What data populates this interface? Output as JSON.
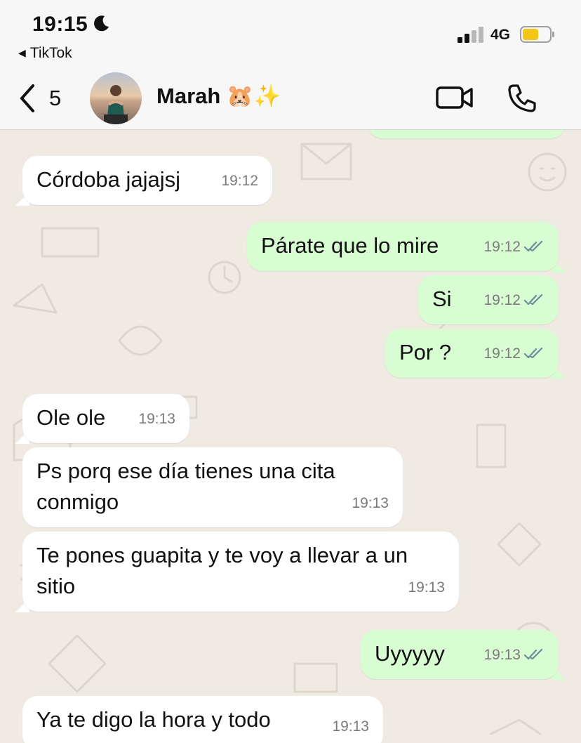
{
  "status_bar": {
    "time": "19:15",
    "back_app": "TikTok",
    "network": "4G"
  },
  "header": {
    "unread_count": "5",
    "contact_name": "Marah 🐹✨"
  },
  "messages": [
    {
      "direction": "in",
      "text": "Córdoba jajajsj",
      "time": "19:12"
    },
    {
      "direction": "out",
      "text": "Párate que lo mire",
      "time": "19:12",
      "status": "read"
    },
    {
      "direction": "out",
      "text": "Si",
      "time": "19:12",
      "status": "read"
    },
    {
      "direction": "out",
      "text": "Por ?",
      "time": "19:12",
      "status": "read"
    },
    {
      "direction": "in",
      "text": "Ole ole",
      "time": "19:13"
    },
    {
      "direction": "in",
      "text": "Ps porq ese día tienes una cita conmigo",
      "time": "19:13"
    },
    {
      "direction": "in",
      "text": "Te pones guapita y te voy a llevar a un sitio",
      "time": "19:13"
    },
    {
      "direction": "out",
      "text": "Uyyyyy",
      "time": "19:13",
      "status": "read"
    },
    {
      "direction": "in",
      "text": "Ya te digo la hora y todo",
      "time": "19:13"
    }
  ],
  "colors": {
    "outgoing_bubble": "#d9fdd3",
    "incoming_bubble": "#ffffff",
    "chat_background": "#efeae2",
    "battery_fill": "#f5c518",
    "read_ticks": "#6f8a98"
  },
  "icons": {
    "moon": "moon-icon",
    "back": "chevron-left-icon",
    "video": "video-camera-icon",
    "call": "phone-icon",
    "ticks": "double-check-icon"
  }
}
